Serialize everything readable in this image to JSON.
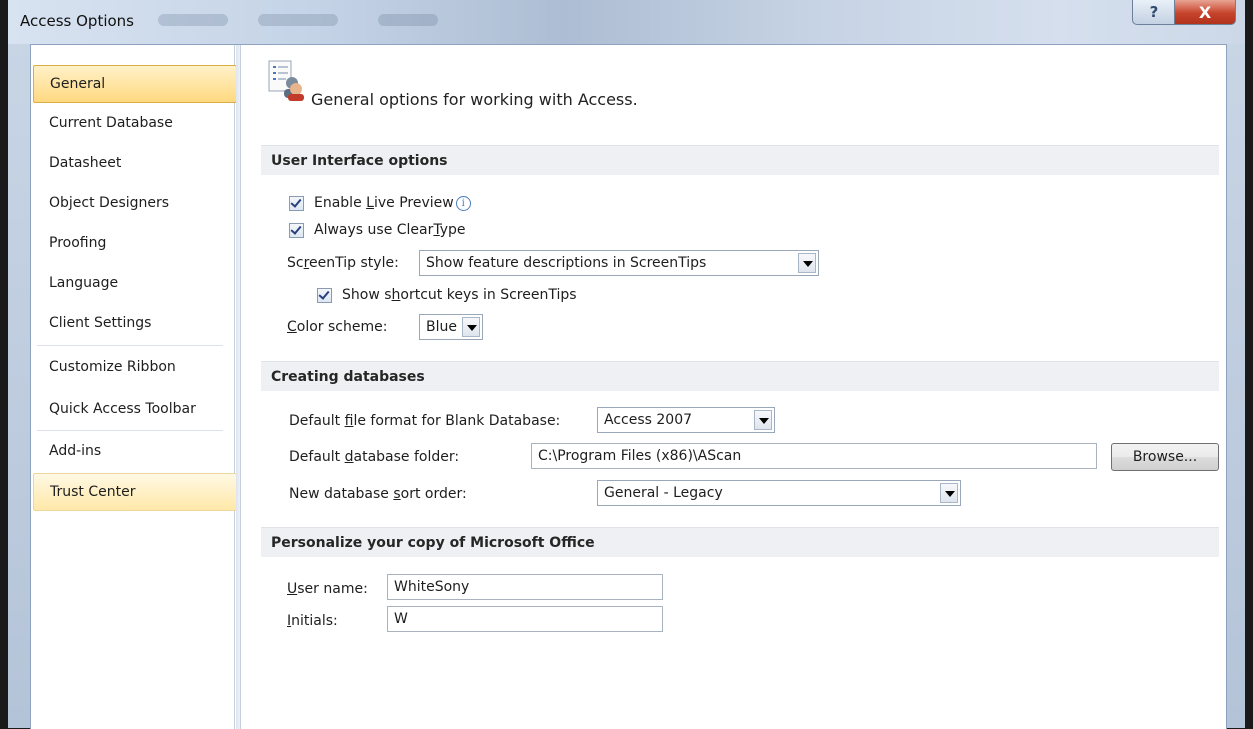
{
  "window": {
    "title": "Access Options",
    "help_icon": "help-icon",
    "help_label": "?",
    "close_icon": "close-icon",
    "close_label": "X"
  },
  "sidebar": {
    "items": [
      {
        "label": "General"
      },
      {
        "label": "Current Database"
      },
      {
        "label": "Datasheet"
      },
      {
        "label": "Object Designers"
      },
      {
        "label": "Proofing"
      },
      {
        "label": "Language"
      },
      {
        "label": "Client Settings"
      },
      {
        "label": "Customize Ribbon"
      },
      {
        "label": "Quick Access Toolbar"
      },
      {
        "label": "Add-ins"
      },
      {
        "label": "Trust Center"
      }
    ]
  },
  "main": {
    "heading": "General options for working with Access.",
    "sections": {
      "ui": {
        "title": "User Interface options",
        "enable_live_preview": {
          "pre": "Enable ",
          "key": "L",
          "post": "ive Preview",
          "checked": true
        },
        "cleartype": {
          "pre": "Always use Clear",
          "key": "T",
          "post": "ype",
          "checked": true
        },
        "screentip": {
          "pre": "Sc",
          "key": "r",
          "post": "eenTip style:",
          "value": "Show feature descriptions in ScreenTips"
        },
        "shortcut_keys": {
          "pre": "Show s",
          "key": "h",
          "post": "ortcut keys in ScreenTips",
          "checked": true
        },
        "color_scheme": {
          "key": "C",
          "post": "olor scheme:",
          "value": "Blue"
        }
      },
      "create": {
        "title": "Creating databases",
        "file_format": {
          "pre": "Default ",
          "key": "f",
          "post": "ile format for Blank Database:",
          "value": "Access 2007"
        },
        "folder": {
          "pre": "Default ",
          "key": "d",
          "post": "atabase folder:",
          "value": "C:\\Program Files (x86)\\AScan"
        },
        "browse_label": "Browse...",
        "sort_order": {
          "pre": "New database ",
          "key": "s",
          "post": "ort order:",
          "value": "General - Legacy"
        }
      },
      "personalize": {
        "title": "Personalize your copy of Microsoft Office",
        "user_name": {
          "key": "U",
          "post": "ser name:",
          "value": "WhiteSony"
        },
        "initials": {
          "key": "I",
          "post": "nitials:",
          "value": "W"
        }
      }
    }
  },
  "colors": {
    "active_nav": "#ffd980",
    "close_button": "#c7432b",
    "section_band": "#eef0f3"
  }
}
